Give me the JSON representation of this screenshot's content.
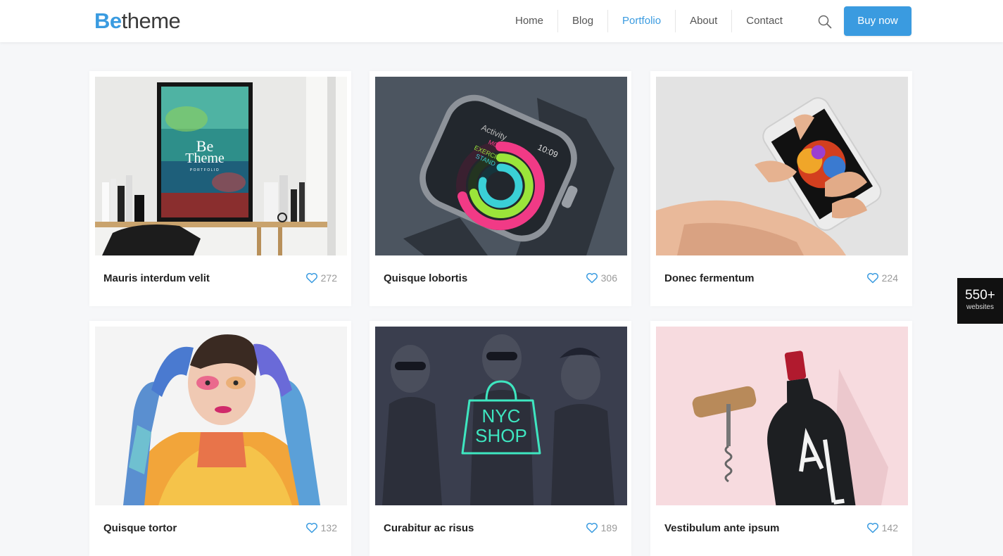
{
  "header": {
    "logo_be": "Be",
    "logo_rest": "theme",
    "nav": [
      {
        "label": "Home",
        "active": false
      },
      {
        "label": "Blog",
        "active": false
      },
      {
        "label": "Portfolio",
        "active": true
      },
      {
        "label": "About",
        "active": false
      },
      {
        "label": "Contact",
        "active": false
      }
    ],
    "search_icon": "search-icon",
    "buy_label": "Buy now"
  },
  "colors": {
    "accent": "#3a9be0",
    "text": "#222222",
    "muted": "#9a9a9a",
    "background": "#f6f7f9"
  },
  "portfolio": {
    "items": [
      {
        "title": "Mauris interdum velit",
        "likes": "272",
        "image": "framed-poster-on-desk"
      },
      {
        "title": "Quisque lobortis",
        "likes": "306",
        "image": "smartwatch-activity"
      },
      {
        "title": "Donec fermentum",
        "likes": "224",
        "image": "hand-holding-phone"
      },
      {
        "title": "Quisque tortor",
        "likes": "132",
        "image": "painted-woman-portrait"
      },
      {
        "title": "Curabitur ac risus",
        "likes": "189",
        "image": "nyc-shop-fashion"
      },
      {
        "title": "Vestibulum ante ipsum",
        "likes": "142",
        "image": "wine-bottle-corkscrew"
      }
    ],
    "poster_text_line1": "Be",
    "poster_text_line2": "Theme",
    "poster_text_line3": "PORTFOLIO",
    "watch_activity": "Activity",
    "watch_time": "10:09",
    "watch_move": "MOVE",
    "watch_exercise": "EXERCISE",
    "watch_stand": "STAND",
    "shop_line1": "NYC",
    "shop_line2": "SHOP"
  },
  "badge": {
    "number": "550+",
    "label": "websites"
  }
}
